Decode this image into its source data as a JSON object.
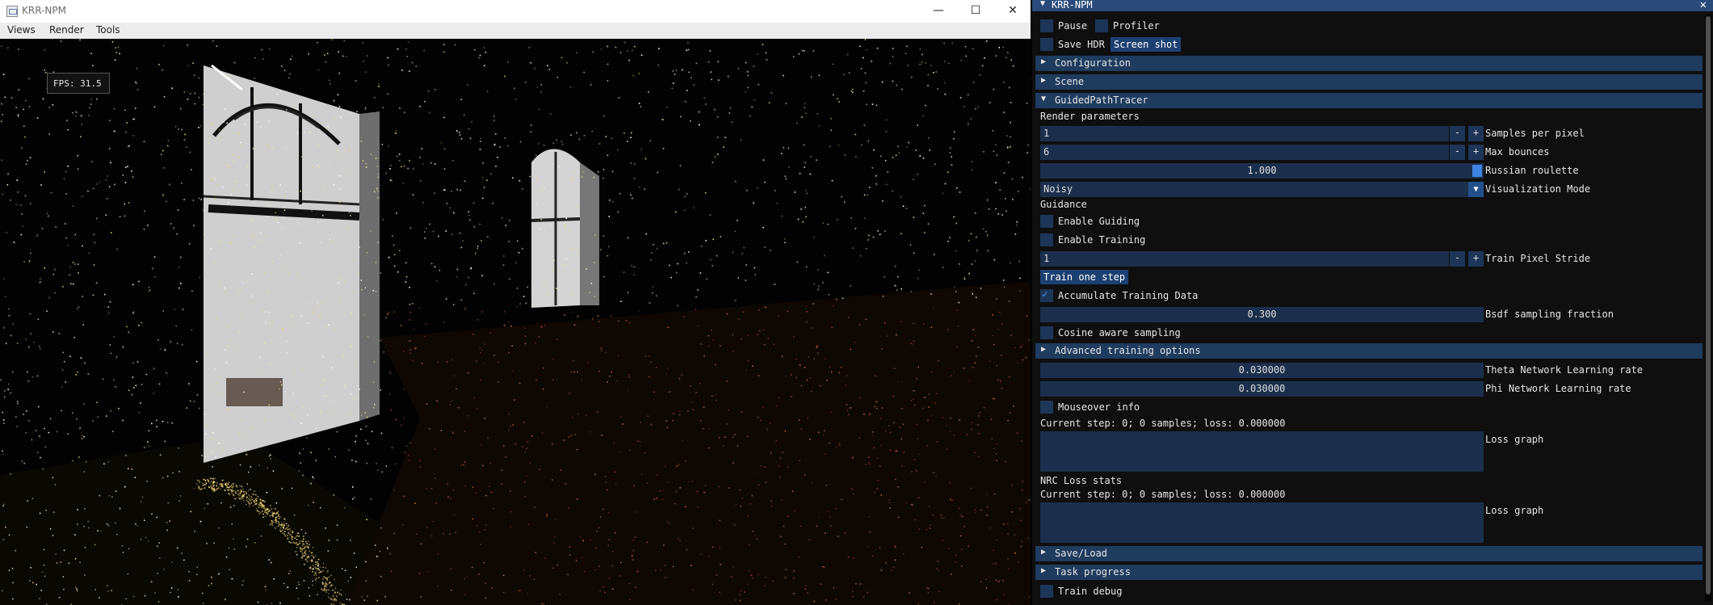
{
  "window": {
    "title": "KRR-NPM",
    "controls": {
      "minimize": "—",
      "maximize": "☐",
      "close": "✕"
    },
    "menu": [
      "Views",
      "Render",
      "Tools"
    ],
    "fps": "FPS: 31.5"
  },
  "panel": {
    "title": "KRR-NPM",
    "pause": {
      "label": "Pause",
      "checked": false
    },
    "profiler": {
      "label": "Profiler",
      "checked": false
    },
    "save_hdr": {
      "label": "Save HDR",
      "checked": false
    },
    "screenshot_label": "Screen shot",
    "sections": {
      "configuration": "Configuration",
      "scene": "Scene",
      "guided": "GuidedPathTracer",
      "advanced": "Advanced training options",
      "saveload": "Save/Load",
      "task_progress": "Task progress"
    },
    "render_parameters": "Render parameters",
    "samples_per_pixel": {
      "value": "1",
      "label": "Samples per pixel"
    },
    "max_bounces": {
      "value": "6",
      "label": "Max bounces"
    },
    "russian_roulette": {
      "value": "1.000",
      "label": "Russian roulette"
    },
    "visualization_mode": {
      "value": "Noisy",
      "label": "Visualization Mode"
    },
    "guidance": "Guidance",
    "enable_guiding": {
      "label": "Enable Guiding",
      "checked": false
    },
    "enable_training": {
      "label": "Enable Training",
      "checked": false
    },
    "train_pixel_stride": {
      "value": "1",
      "label": "Train Pixel Stride"
    },
    "train_one_step": "Train one step",
    "accumulate_training": {
      "label": "Accumulate Training Data",
      "checked": true
    },
    "bsdf_fraction": {
      "value": "0.300",
      "label": "Bsdf sampling fraction"
    },
    "cosine_aware": {
      "label": "Cosine aware sampling",
      "checked": false
    },
    "theta_lr": {
      "value": "0.030000",
      "label": "Theta Network Learning rate"
    },
    "phi_lr": {
      "value": "0.030000",
      "label": "Phi Network Learning rate"
    },
    "mouseover_info": {
      "label": "Mouseover info",
      "checked": false
    },
    "status1": "Current step: 0; 0 samples; loss: 0.000000",
    "loss_graph1": "Loss graph",
    "nrc_loss_stats": "NRC Loss stats",
    "status2": "Current step: 0; 0 samples; loss: 0.000000",
    "loss_graph2": "Loss graph",
    "train_debug": {
      "label": "Train debug",
      "checked": false
    },
    "minus": "-",
    "plus": "+"
  },
  "colors": {
    "title_active": "#294a7a",
    "header": "#1f3b5e",
    "frame_bg": "#1b2f4c",
    "button": "#1d4072",
    "check": "#4296fa",
    "panel_bg": "#0f0f0f"
  }
}
